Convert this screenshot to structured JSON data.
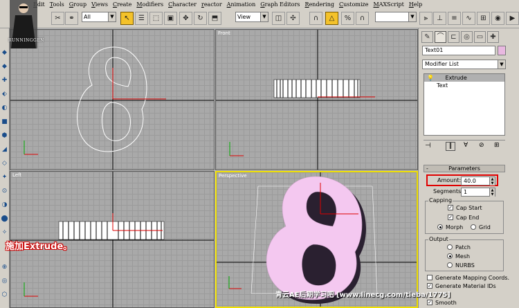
{
  "menu": [
    "Edit",
    "Tools",
    "Group",
    "Views",
    "Create",
    "Modifiers",
    "Character",
    "reactor",
    "Animation",
    "Graph Editors",
    "Rendering",
    "Customize",
    "MAXScript",
    "Help"
  ],
  "logo": {
    "text": "RUNNINGGEN"
  },
  "toolbar": {
    "selection_filter": "All",
    "reference_coord": "View"
  },
  "viewports": {
    "top_left": {
      "label": ""
    },
    "front": {
      "label": "Front"
    },
    "left": {
      "label": "Left"
    },
    "perspective": {
      "label": "Perspective"
    }
  },
  "command_panel": {
    "object_name": "Text01",
    "object_color": "#e8b8e0",
    "modifier_list": "Modifier List",
    "stack": [
      "Extrude",
      "Text"
    ],
    "parameters": {
      "title": "Parameters",
      "amount_label": "Amount:",
      "amount_value": "40.0",
      "segments_label": "Segments:",
      "segments_value": "1",
      "capping_title": "Capping",
      "cap_start": "Cap Start",
      "cap_end": "Cap End",
      "morph": "Morph",
      "grid": "Grid",
      "output_title": "Output",
      "patch": "Patch",
      "mesh": "Mesh",
      "nurbs": "NURBS",
      "gen_mapping": "Generate Mapping Coords.",
      "gen_material": "Generate Material IDs",
      "smooth": "Smooth"
    }
  },
  "overlay": {
    "caption": "施加Extrude。",
    "watermark": "青云AE后期学习吧 [www.linecg.com/tieba/1775]"
  },
  "colors": {
    "highlight": "#e00000",
    "pink_object": "#f4c8f0",
    "active_viewport": "#f0e000"
  }
}
